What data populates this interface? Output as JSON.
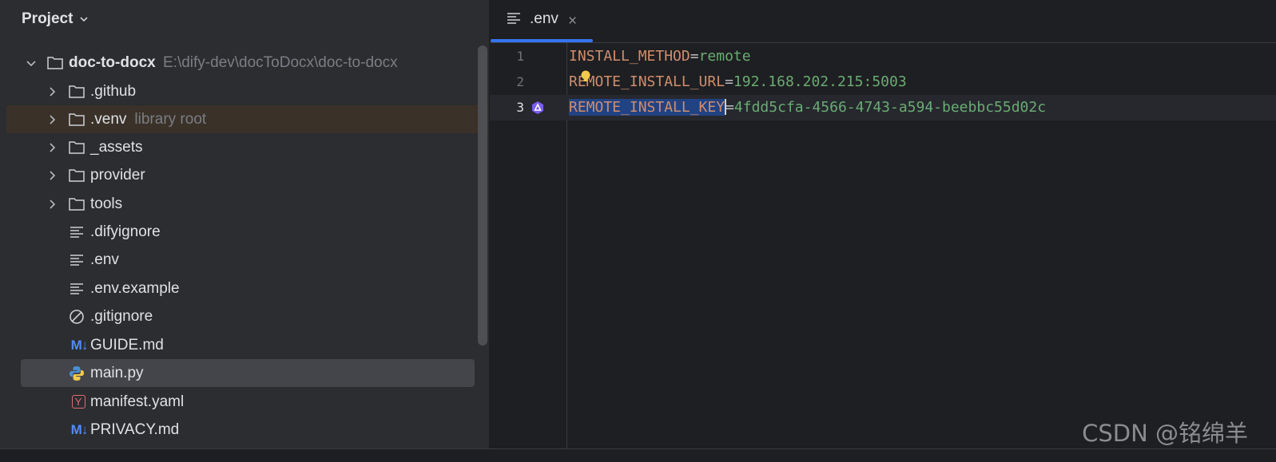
{
  "project": {
    "title": "Project",
    "root": {
      "name": "doc-to-docx",
      "path": "E:\\dify-dev\\docToDocx\\doc-to-docx"
    },
    "items": [
      {
        "label": ".github",
        "type": "folder"
      },
      {
        "label": ".venv",
        "hint": "library root",
        "type": "folder"
      },
      {
        "label": "_assets",
        "type": "folder"
      },
      {
        "label": "provider",
        "type": "folder"
      },
      {
        "label": "tools",
        "type": "folder"
      },
      {
        "label": ".difyignore",
        "type": "text"
      },
      {
        "label": ".env",
        "type": "text"
      },
      {
        "label": ".env.example",
        "type": "text"
      },
      {
        "label": ".gitignore",
        "type": "ignore"
      },
      {
        "label": "GUIDE.md",
        "type": "markdown",
        "icon_text": "M↓"
      },
      {
        "label": "main.py",
        "type": "python"
      },
      {
        "label": "manifest.yaml",
        "type": "yaml",
        "icon_text": "Y"
      },
      {
        "label": "PRIVACY.md",
        "type": "markdown",
        "icon_text": "M↓"
      }
    ]
  },
  "editor": {
    "tab": {
      "name": ".env",
      "close": "×"
    },
    "lines": [
      {
        "num": "1",
        "key": "INSTALL_METHOD",
        "eq": "=",
        "value": "remote"
      },
      {
        "num": "2",
        "key": "REMOTE_INSTALL_URL",
        "eq": "=",
        "value": "192.168.202.215:5003"
      },
      {
        "num": "3",
        "key": "REMOTE_INSTALL_KEY",
        "eq": "=",
        "value": "4fdd5cfa-4566-4743-a594-beebbc55d02c"
      }
    ]
  },
  "watermark": "CSDN @铭绵羊",
  "colors": {
    "panel_bg": "#2b2d30",
    "editor_bg": "#1e1f22",
    "accent": "#3574f0",
    "key": "#cf8e6d",
    "value": "#6aab73",
    "selection": "#214283"
  }
}
